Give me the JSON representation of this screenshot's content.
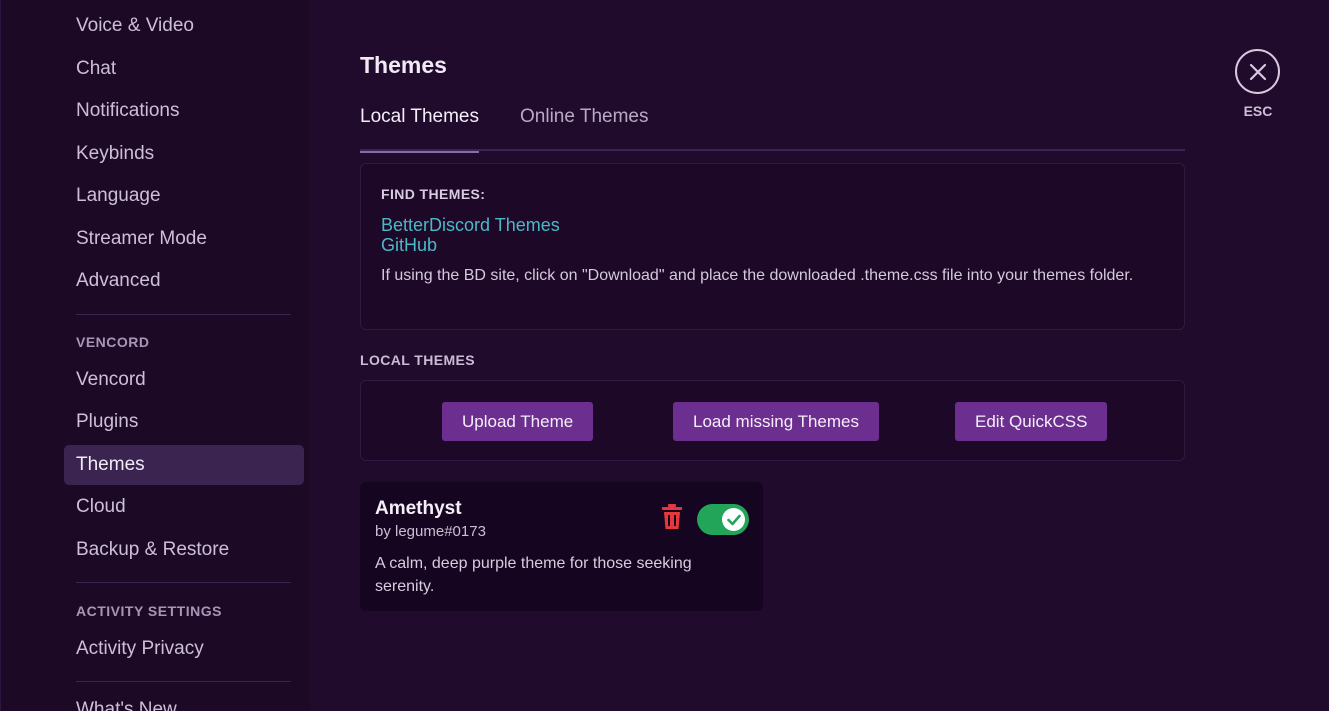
{
  "sidebar": {
    "items_top": [
      {
        "label": "Voice & Video"
      },
      {
        "label": "Chat"
      },
      {
        "label": "Notifications"
      },
      {
        "label": "Keybinds"
      },
      {
        "label": "Language"
      },
      {
        "label": "Streamer Mode"
      },
      {
        "label": "Advanced"
      }
    ],
    "vencord_header": "VENCORD",
    "vencord_items": [
      {
        "label": "Vencord"
      },
      {
        "label": "Plugins"
      },
      {
        "label": "Themes",
        "active": true
      },
      {
        "label": "Cloud"
      },
      {
        "label": "Backup & Restore"
      }
    ],
    "activity_header": "ACTIVITY SETTINGS",
    "activity_items": [
      {
        "label": "Activity Privacy"
      }
    ],
    "whats_new": "What's New"
  },
  "main": {
    "title": "Themes",
    "tabs": [
      {
        "label": "Local Themes",
        "active": true
      },
      {
        "label": "Online Themes",
        "active": false
      }
    ],
    "find_themes": {
      "header": "FIND THEMES:",
      "links": [
        "BetterDiscord Themes",
        "GitHub"
      ],
      "description": "If using the BD site, click on \"Download\" and place the downloaded .theme.css file into your themes folder."
    },
    "local_themes_label": "LOCAL THEMES",
    "buttons": {
      "upload": "Upload Theme",
      "load_missing": "Load missing Themes",
      "edit_quickcss": "Edit QuickCSS"
    },
    "theme": {
      "name": "Amethyst",
      "author": "by legume#0173",
      "description": "A calm, deep purple theme for those seeking serenity.",
      "enabled": true
    }
  },
  "close": {
    "label": "ESC"
  },
  "colors": {
    "accent_button": "#6c2e8f",
    "link": "#4bb8c8",
    "toggle_on": "#23a559",
    "trash": "#e3393c"
  }
}
